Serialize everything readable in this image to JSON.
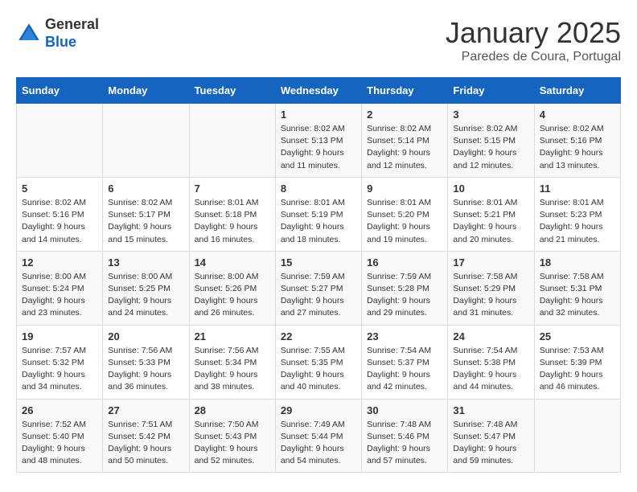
{
  "logo": {
    "general": "General",
    "blue": "Blue"
  },
  "title": "January 2025",
  "subtitle": "Paredes de Coura, Portugal",
  "days_header": [
    "Sunday",
    "Monday",
    "Tuesday",
    "Wednesday",
    "Thursday",
    "Friday",
    "Saturday"
  ],
  "weeks": [
    [
      {
        "day": "",
        "text": ""
      },
      {
        "day": "",
        "text": ""
      },
      {
        "day": "",
        "text": ""
      },
      {
        "day": "1",
        "text": "Sunrise: 8:02 AM\nSunset: 5:13 PM\nDaylight: 9 hours\nand 11 minutes."
      },
      {
        "day": "2",
        "text": "Sunrise: 8:02 AM\nSunset: 5:14 PM\nDaylight: 9 hours\nand 12 minutes."
      },
      {
        "day": "3",
        "text": "Sunrise: 8:02 AM\nSunset: 5:15 PM\nDaylight: 9 hours\nand 12 minutes."
      },
      {
        "day": "4",
        "text": "Sunrise: 8:02 AM\nSunset: 5:16 PM\nDaylight: 9 hours\nand 13 minutes."
      }
    ],
    [
      {
        "day": "5",
        "text": "Sunrise: 8:02 AM\nSunset: 5:16 PM\nDaylight: 9 hours\nand 14 minutes."
      },
      {
        "day": "6",
        "text": "Sunrise: 8:02 AM\nSunset: 5:17 PM\nDaylight: 9 hours\nand 15 minutes."
      },
      {
        "day": "7",
        "text": "Sunrise: 8:01 AM\nSunset: 5:18 PM\nDaylight: 9 hours\nand 16 minutes."
      },
      {
        "day": "8",
        "text": "Sunrise: 8:01 AM\nSunset: 5:19 PM\nDaylight: 9 hours\nand 18 minutes."
      },
      {
        "day": "9",
        "text": "Sunrise: 8:01 AM\nSunset: 5:20 PM\nDaylight: 9 hours\nand 19 minutes."
      },
      {
        "day": "10",
        "text": "Sunrise: 8:01 AM\nSunset: 5:21 PM\nDaylight: 9 hours\nand 20 minutes."
      },
      {
        "day": "11",
        "text": "Sunrise: 8:01 AM\nSunset: 5:23 PM\nDaylight: 9 hours\nand 21 minutes."
      }
    ],
    [
      {
        "day": "12",
        "text": "Sunrise: 8:00 AM\nSunset: 5:24 PM\nDaylight: 9 hours\nand 23 minutes."
      },
      {
        "day": "13",
        "text": "Sunrise: 8:00 AM\nSunset: 5:25 PM\nDaylight: 9 hours\nand 24 minutes."
      },
      {
        "day": "14",
        "text": "Sunrise: 8:00 AM\nSunset: 5:26 PM\nDaylight: 9 hours\nand 26 minutes."
      },
      {
        "day": "15",
        "text": "Sunrise: 7:59 AM\nSunset: 5:27 PM\nDaylight: 9 hours\nand 27 minutes."
      },
      {
        "day": "16",
        "text": "Sunrise: 7:59 AM\nSunset: 5:28 PM\nDaylight: 9 hours\nand 29 minutes."
      },
      {
        "day": "17",
        "text": "Sunrise: 7:58 AM\nSunset: 5:29 PM\nDaylight: 9 hours\nand 31 minutes."
      },
      {
        "day": "18",
        "text": "Sunrise: 7:58 AM\nSunset: 5:31 PM\nDaylight: 9 hours\nand 32 minutes."
      }
    ],
    [
      {
        "day": "19",
        "text": "Sunrise: 7:57 AM\nSunset: 5:32 PM\nDaylight: 9 hours\nand 34 minutes."
      },
      {
        "day": "20",
        "text": "Sunrise: 7:56 AM\nSunset: 5:33 PM\nDaylight: 9 hours\nand 36 minutes."
      },
      {
        "day": "21",
        "text": "Sunrise: 7:56 AM\nSunset: 5:34 PM\nDaylight: 9 hours\nand 38 minutes."
      },
      {
        "day": "22",
        "text": "Sunrise: 7:55 AM\nSunset: 5:35 PM\nDaylight: 9 hours\nand 40 minutes."
      },
      {
        "day": "23",
        "text": "Sunrise: 7:54 AM\nSunset: 5:37 PM\nDaylight: 9 hours\nand 42 minutes."
      },
      {
        "day": "24",
        "text": "Sunrise: 7:54 AM\nSunset: 5:38 PM\nDaylight: 9 hours\nand 44 minutes."
      },
      {
        "day": "25",
        "text": "Sunrise: 7:53 AM\nSunset: 5:39 PM\nDaylight: 9 hours\nand 46 minutes."
      }
    ],
    [
      {
        "day": "26",
        "text": "Sunrise: 7:52 AM\nSunset: 5:40 PM\nDaylight: 9 hours\nand 48 minutes."
      },
      {
        "day": "27",
        "text": "Sunrise: 7:51 AM\nSunset: 5:42 PM\nDaylight: 9 hours\nand 50 minutes."
      },
      {
        "day": "28",
        "text": "Sunrise: 7:50 AM\nSunset: 5:43 PM\nDaylight: 9 hours\nand 52 minutes."
      },
      {
        "day": "29",
        "text": "Sunrise: 7:49 AM\nSunset: 5:44 PM\nDaylight: 9 hours\nand 54 minutes."
      },
      {
        "day": "30",
        "text": "Sunrise: 7:48 AM\nSunset: 5:46 PM\nDaylight: 9 hours\nand 57 minutes."
      },
      {
        "day": "31",
        "text": "Sunrise: 7:48 AM\nSunset: 5:47 PM\nDaylight: 9 hours\nand 59 minutes."
      },
      {
        "day": "",
        "text": ""
      }
    ]
  ]
}
